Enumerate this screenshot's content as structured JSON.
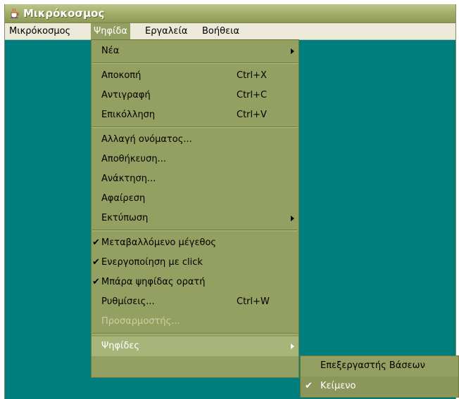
{
  "window": {
    "title": "Μικρόκοσμος",
    "icon": "java-cup-icon"
  },
  "menubar": {
    "items": [
      {
        "label": "Μικρόκοσμος"
      },
      {
        "label": "Ψηφίδα"
      },
      {
        "label": "Εργαλεία"
      },
      {
        "label": "Βοήθεια"
      }
    ]
  },
  "menu": {
    "items": [
      {
        "label": "Νέα",
        "submenu": true
      },
      {
        "label": "Αποκοπή",
        "shortcut": "Ctrl+X"
      },
      {
        "label": "Αντιγραφή",
        "shortcut": "Ctrl+C"
      },
      {
        "label": "Επικόλληση",
        "shortcut": "Ctrl+V"
      },
      {
        "label": "Αλλαγή ονόματος..."
      },
      {
        "label": "Αποθήκευση..."
      },
      {
        "label": "Ανάκτηση..."
      },
      {
        "label": "Αφαίρεση"
      },
      {
        "label": "Εκτύπωση",
        "submenu": true
      },
      {
        "label": "Μεταβαλλόμενο μέγεθος",
        "checked": true
      },
      {
        "label": "Ενεργοποίηση με click",
        "checked": true
      },
      {
        "label": "Μπάρα ψηφίδας ορατή",
        "checked": true
      },
      {
        "label": "Ρυθμίσεις...",
        "shortcut": "Ctrl+W"
      },
      {
        "label": "Προσαρμοστής...",
        "disabled": true
      },
      {
        "label": "Ψηφίδες",
        "submenu": true,
        "highlighted": true
      }
    ]
  },
  "submenu": {
    "items": [
      {
        "label": "Επεξεργαστής Βάσεων"
      },
      {
        "label": "Κείμενο",
        "checked": true,
        "highlighted": true
      }
    ]
  },
  "colors": {
    "desktop": "#007e7e",
    "menu_bg": "#94a061",
    "menubar_bg": "#ece9d8"
  }
}
